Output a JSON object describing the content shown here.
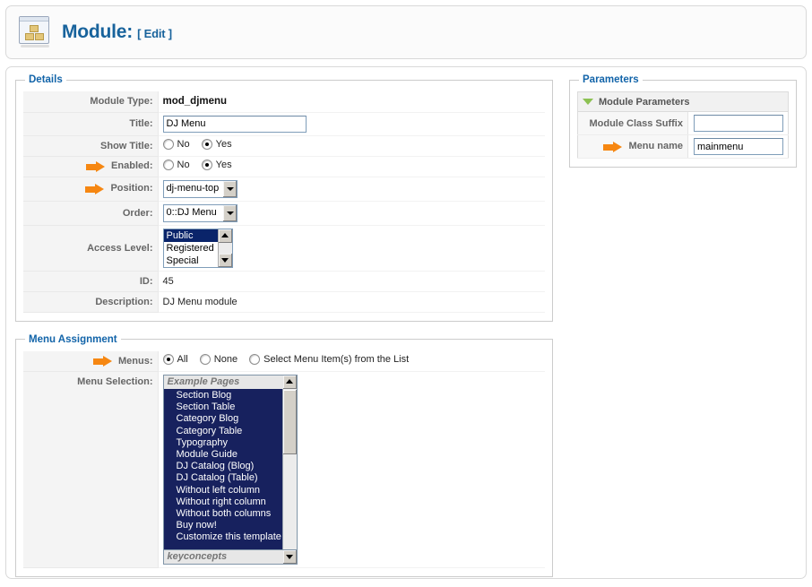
{
  "header": {
    "icon": "module-boxes-icon",
    "title": "Module:",
    "mode": "[ Edit ]"
  },
  "details": {
    "legend": "Details",
    "rows": {
      "module_type_label": "Module Type:",
      "module_type_value": "mod_djmenu",
      "title_label": "Title:",
      "title_value": "DJ Menu",
      "show_title_label": "Show Title:",
      "enabled_label": "Enabled:",
      "position_label": "Position:",
      "position_value": "dj-menu-top",
      "order_label": "Order:",
      "order_value": "0::DJ Menu",
      "access_label": "Access Level:",
      "id_label": "ID:",
      "id_value": "45",
      "description_label": "Description:",
      "description_value": "DJ Menu module"
    },
    "yesno": {
      "no": "No",
      "yes": "Yes"
    },
    "show_title_selected": "Yes",
    "enabled_selected": "Yes",
    "access_options": [
      "Public",
      "Registered",
      "Special"
    ],
    "access_selected": "Public"
  },
  "menu_assignment": {
    "legend": "Menu Assignment",
    "menus_label": "Menus:",
    "menus_options": [
      "All",
      "None",
      "Select Menu Item(s) from the List"
    ],
    "menus_selected": "All",
    "menu_selection_label": "Menu Selection:",
    "group_top": "Example Pages",
    "group_bottom": "keyconcepts",
    "items": [
      "Section Blog",
      "Section Table",
      "Category Blog",
      "Category Table",
      "Typography",
      "Module Guide",
      "DJ Catalog (Blog)",
      "DJ Catalog (Table)",
      "Without left column",
      "Without right column",
      "Without both columns",
      "Buy now!",
      "Customize this template"
    ]
  },
  "parameters": {
    "legend": "Parameters",
    "section_title": "Module Parameters",
    "rows": [
      {
        "label": "Module Class Suffix",
        "value": "",
        "marked": false
      },
      {
        "label": "Menu name",
        "value": "mainmenu",
        "marked": true
      }
    ]
  },
  "colors": {
    "legend_blue": "#1264a9",
    "title_blue": "#18639c",
    "arrow_orange": "#f68712",
    "listbox_navy": "#17215e",
    "select_highlight": "#0a246a",
    "toggle_green": "#8cc152"
  }
}
